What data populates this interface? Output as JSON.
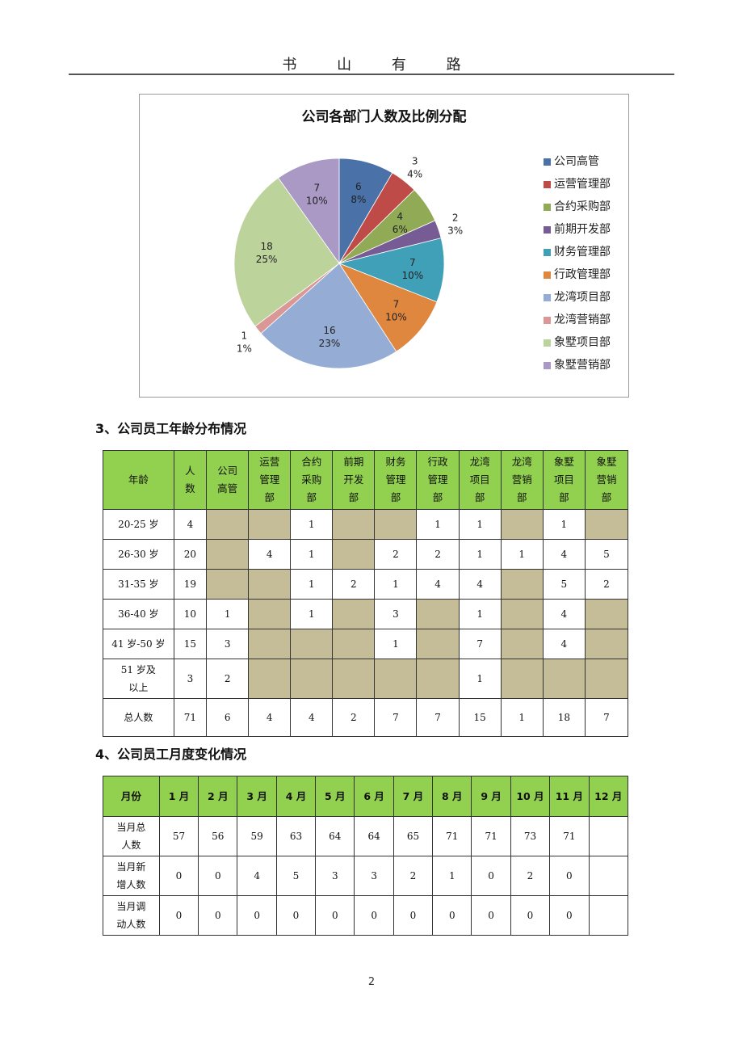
{
  "header": {
    "title": "书 山 有 路"
  },
  "chart_data": {
    "type": "pie",
    "title": "公司各部门人数及比例分配",
    "legend_position": "right",
    "slices": [
      {
        "label": "公司高管",
        "value": 6,
        "percent": "8%",
        "color": "#4a72a8"
      },
      {
        "label": "运营管理部",
        "value": 3,
        "percent": "4%",
        "color": "#bf4b49"
      },
      {
        "label": "合约采购部",
        "value": 4,
        "percent": "6%",
        "color": "#90aa56"
      },
      {
        "label": "前期开发部",
        "value": 2,
        "percent": "3%",
        "color": "#775b95"
      },
      {
        "label": "财务管理部",
        "value": 7,
        "percent": "10%",
        "color": "#3fa0b8"
      },
      {
        "label": "行政管理部",
        "value": 7,
        "percent": "10%",
        "color": "#e0873f"
      },
      {
        "label": "龙湾项目部",
        "value": 16,
        "percent": "23%",
        "color": "#95acd4"
      },
      {
        "label": "龙湾营销部",
        "value": 1,
        "percent": "1%",
        "color": "#d99795"
      },
      {
        "label": "象墅项目部",
        "value": 18,
        "percent": "25%",
        "color": "#bcd39b"
      },
      {
        "label": "象墅营销部",
        "value": 7,
        "percent": "10%",
        "color": "#a999c4"
      }
    ]
  },
  "age_section": {
    "heading": "3、公司员工年龄分布情况",
    "columns": [
      [
        "年龄"
      ],
      [
        "人",
        "数"
      ],
      [
        "公司",
        "高管"
      ],
      [
        "运营",
        "管理",
        "部"
      ],
      [
        "合约",
        "采购",
        "部"
      ],
      [
        "前期",
        "开发",
        "部"
      ],
      [
        "财务",
        "管理",
        "部"
      ],
      [
        "行政",
        "管理",
        "部"
      ],
      [
        "龙湾",
        "项目",
        "部"
      ],
      [
        "龙湾",
        "营销",
        "部"
      ],
      [
        "象墅",
        "项目",
        "部"
      ],
      [
        "象墅",
        "营销",
        "部"
      ]
    ],
    "rows": [
      {
        "label": [
          "20-25 岁"
        ],
        "cells": [
          "4",
          null,
          null,
          "1",
          null,
          null,
          "1",
          "1",
          null,
          "1",
          null
        ]
      },
      {
        "label": [
          "26-30 岁"
        ],
        "cells": [
          "20",
          null,
          "4",
          "1",
          null,
          "2",
          "2",
          "1",
          "1",
          "4",
          "5"
        ]
      },
      {
        "label": [
          "31-35 岁"
        ],
        "cells": [
          "19",
          null,
          null,
          "1",
          "2",
          "1",
          "4",
          "4",
          null,
          "5",
          "2"
        ]
      },
      {
        "label": [
          "36-40 岁"
        ],
        "cells": [
          "10",
          "1",
          null,
          "1",
          null,
          "3",
          null,
          "1",
          null,
          "4",
          null
        ]
      },
      {
        "label": [
          "41 岁-50 岁"
        ],
        "cells": [
          "15",
          "3",
          null,
          null,
          null,
          "1",
          null,
          "7",
          null,
          "4",
          null
        ]
      },
      {
        "label": [
          "51 岁及",
          "以上"
        ],
        "cells": [
          "3",
          "2",
          null,
          null,
          null,
          null,
          null,
          "1",
          null,
          null,
          null
        ]
      },
      {
        "label": [
          "总人数"
        ],
        "cells": [
          "71",
          "6",
          "4",
          "4",
          "2",
          "7",
          "7",
          "15",
          "1",
          "18",
          "7"
        ],
        "total": true
      }
    ],
    "colors": {
      "header_bg": "#92d050",
      "empty_cell_bg": "#c4bd97"
    }
  },
  "monthly_section": {
    "heading": "4、公司员工月度变化情况",
    "columns": [
      "月份",
      "1 月",
      "2 月",
      "3 月",
      "4 月",
      "5 月",
      "6 月",
      "7 月",
      "8 月",
      "9 月",
      "10 月",
      "11 月",
      "12 月"
    ],
    "rows": [
      {
        "label": [
          "当月总",
          "人数"
        ],
        "cells": [
          "57",
          "56",
          "59",
          "63",
          "64",
          "64",
          "65",
          "71",
          "71",
          "73",
          "71",
          ""
        ]
      },
      {
        "label": [
          "当月新",
          "增人数"
        ],
        "cells": [
          "0",
          "0",
          "4",
          "5",
          "3",
          "3",
          "2",
          "1",
          "0",
          "2",
          "0",
          ""
        ]
      },
      {
        "label": [
          "当月调",
          "动人数"
        ],
        "cells": [
          "0",
          "0",
          "0",
          "0",
          "0",
          "0",
          "0",
          "0",
          "0",
          "0",
          "0",
          ""
        ]
      }
    ]
  },
  "footer": {
    "page_number": "2"
  }
}
